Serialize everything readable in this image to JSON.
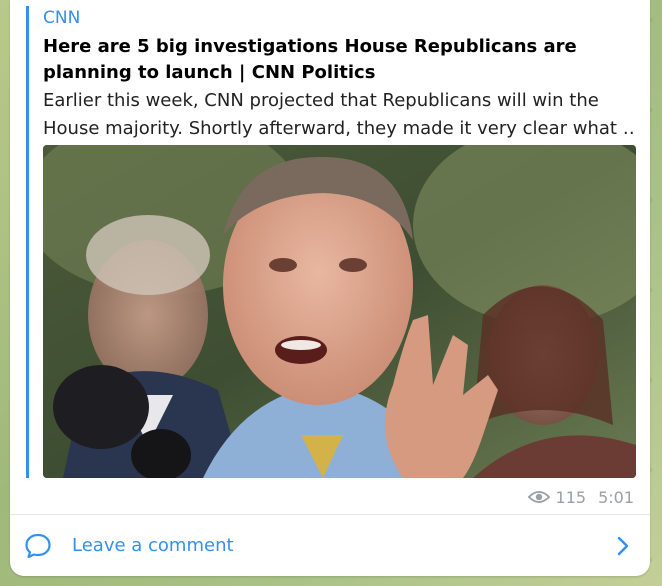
{
  "message": {
    "link_preview": {
      "site_name": "CNN",
      "title": "Here are 5 big investigations House Republicans are planning to launch | CNN Politics",
      "description_line1": "Earlier this week, CNN projected that Republicans will win the",
      "description_line2": "House majority. Shortly afterward, they made it very clear what …",
      "image_icon": "news-photo"
    },
    "meta": {
      "views": "115",
      "time": "5:01",
      "views_icon": "eye-icon"
    },
    "comment_bar": {
      "label": "Leave a comment",
      "icon": "speech-bubble-icon",
      "chevron_icon": "chevron-right-icon"
    }
  },
  "colors": {
    "accent": "#3390ec",
    "meta_text": "#9aa0a6",
    "bubble": "#ffffff"
  }
}
